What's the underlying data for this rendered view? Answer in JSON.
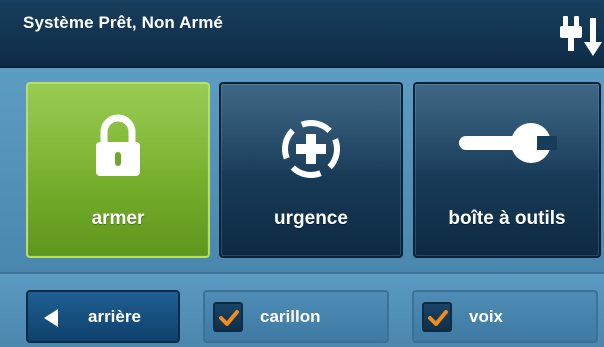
{
  "header": {
    "status_text": "Système Prêt, Non Armé",
    "power_icon": "plug-arrow-icon"
  },
  "tiles": [
    {
      "label": "armer",
      "icon": "padlock-icon",
      "state": "active",
      "color": "#79b22e"
    },
    {
      "label": "urgence",
      "icon": "emergency-cross-icon",
      "state": "normal",
      "color": "#183d5a"
    },
    {
      "label": "boîte à outils",
      "icon": "wrench-icon",
      "state": "normal",
      "color": "#183d5a"
    }
  ],
  "footer": {
    "back_label": "arrière",
    "back_icon": "left-triangle-icon",
    "chime": {
      "label": "carillon",
      "checked": true
    },
    "voice": {
      "label": "voix",
      "checked": true
    },
    "check_color": "#f28c1c"
  }
}
